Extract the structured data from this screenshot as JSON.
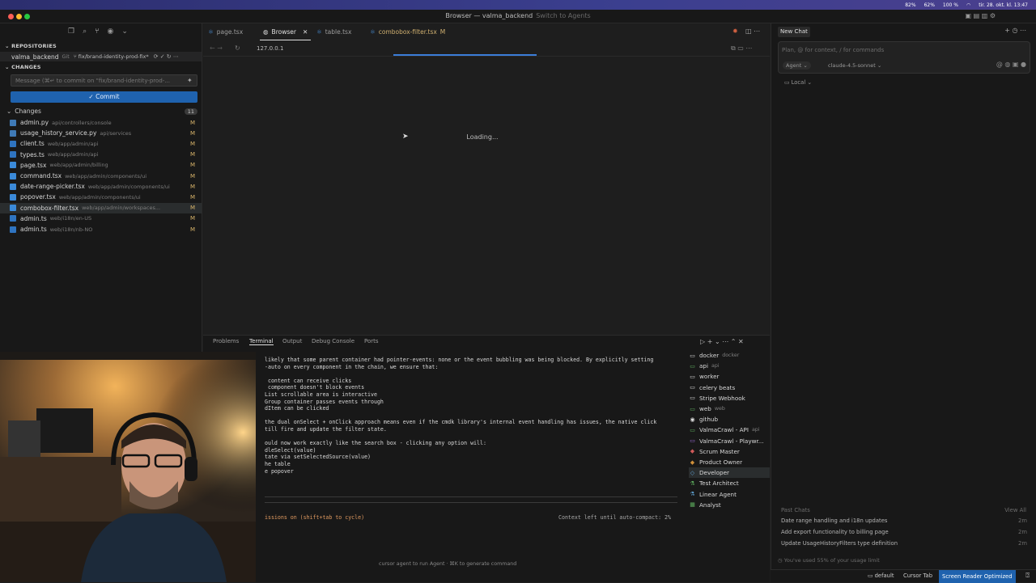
{
  "menubar": {
    "cpu": "82%",
    "mem": "62%",
    "battery": "100 %",
    "datetime": "tir. 28. okt. kl. 13:47"
  },
  "window": {
    "title": "Browser — valma_backend",
    "switch_label": "Switch to Agents"
  },
  "sidebar": {
    "repositories_label": "REPOSITORIES",
    "repo_name": "valma_backend",
    "repo_vcs": "Git",
    "branch": "fix/brand-identity-prod-fix*",
    "changes_section_label": "CHANGES",
    "commit_placeholder": "Message (⌘↵ to commit on \"fix/brand-identity-prod-...",
    "commit_label": "✓ Commit",
    "changes_group_label": "Changes",
    "changes_count": "11",
    "files": [
      {
        "name": "admin.py",
        "path": "api/controllers/console",
        "status": "M"
      },
      {
        "name": "usage_history_service.py",
        "path": "api/services",
        "status": "M"
      },
      {
        "name": "client.ts",
        "path": "web/app/admin/api",
        "status": "M"
      },
      {
        "name": "types.ts",
        "path": "web/app/admin/api",
        "status": "M"
      },
      {
        "name": "page.tsx",
        "path": "web/app/admin/billing",
        "status": "M"
      },
      {
        "name": "command.tsx",
        "path": "web/app/admin/components/ui",
        "status": "M"
      },
      {
        "name": "date-range-picker.tsx",
        "path": "web/app/admin/components/ui",
        "status": "M"
      },
      {
        "name": "popover.tsx",
        "path": "web/app/admin/components/ui",
        "status": "M"
      },
      {
        "name": "combobox-filter.tsx",
        "path": "web/app/admin/workspaces...",
        "status": "M"
      },
      {
        "name": "admin.ts",
        "path": "web/i18n/en-US",
        "status": "M"
      },
      {
        "name": "admin.ts",
        "path": "web/i18n/nb-NO",
        "status": "M"
      }
    ]
  },
  "editor": {
    "tabs": [
      {
        "label": "page.tsx"
      },
      {
        "label": "Browser"
      },
      {
        "label": "table.tsx"
      },
      {
        "label": "combobox-filter.tsx",
        "badge": "M"
      }
    ],
    "url": "127.0.0.1",
    "loading_text": "Loading..."
  },
  "panel": {
    "tabs": [
      "Problems",
      "Terminal",
      "Output",
      "Debug Console",
      "Ports"
    ],
    "terminal_lines": [
      "likely that some parent container had pointer-events: none or the event bubbling was being blocked. By explicitly setting",
      "-auto on every component in the chain, we ensure that:",
      "",
      " content can receive clicks",
      " component doesn't block events",
      "List scrollable area is interactive",
      "Group container passes events through",
      "dItem can be clicked",
      "",
      "the dual onSelect + onClick approach means even if the cmdk library's internal event handling has issues, the native click",
      "till fire and update the filter state.",
      "",
      "ould now work exactly like the search box - clicking any option will:",
      "dleSelect(value)",
      "tate via setSelectedSource(value)",
      "he table",
      "e popover"
    ],
    "permissions_text": "issions on (shift+tab to cycle)",
    "context_text": "Context left until auto-compact: 2%",
    "hint_text": "cursor agent to run Agent · ⌘K to generate command",
    "terminal_list": [
      {
        "name": "docker",
        "suffix": "docker"
      },
      {
        "name": "api",
        "suffix": "api"
      },
      {
        "name": "worker",
        "suffix": ""
      },
      {
        "name": "celery beats",
        "suffix": ""
      },
      {
        "name": "Stripe Webhook",
        "suffix": ""
      },
      {
        "name": "web",
        "suffix": "web"
      },
      {
        "name": "github",
        "suffix": ""
      },
      {
        "name": "ValmaCrawl - API",
        "suffix": "api"
      },
      {
        "name": "ValmaCrawl - Playwr...",
        "suffix": ""
      },
      {
        "name": "Scrum Master",
        "suffix": ""
      },
      {
        "name": "Product Owner",
        "suffix": ""
      },
      {
        "name": "Developer",
        "suffix": ""
      },
      {
        "name": "Test Architect",
        "suffix": ""
      },
      {
        "name": "Linear Agent",
        "suffix": ""
      },
      {
        "name": "Analyst",
        "suffix": ""
      }
    ]
  },
  "chat": {
    "title": "New Chat",
    "placeholder": "Plan, @ for context, / for commands",
    "agent_label": "Agent",
    "model_label": "claude-4.5-sonnet",
    "local_label": "Local",
    "past_chats_label": "Past Chats",
    "view_all_label": "View All",
    "past_chats": [
      {
        "title": "Date range handling and i18n updates",
        "age": "2m"
      },
      {
        "title": "Add export functionality to billing page",
        "age": "2m"
      },
      {
        "title": "Update UsageHistoryFilters type definition",
        "age": "2m"
      }
    ],
    "usage_text": "You've used 55% of your usage limit"
  },
  "statusbar": {
    "shell": "default",
    "cursor_tab": "Cursor Tab",
    "screen_reader": "Screen Reader Optimized"
  }
}
